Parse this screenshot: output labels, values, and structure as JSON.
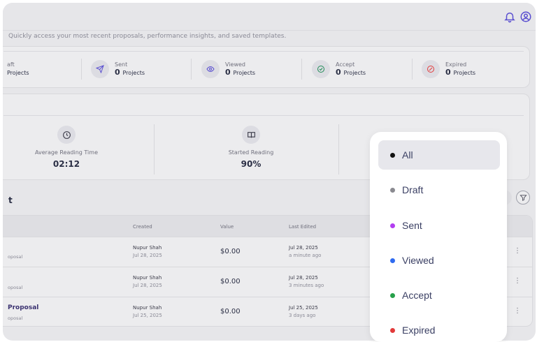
{
  "header": {
    "bell_icon": "bell-icon",
    "profile_icon": "user-circle-icon"
  },
  "overview": {
    "subtitle": "Quickly access your most recent proposals, performance insights, and saved templates.",
    "stats": [
      {
        "label": "aft",
        "count": "",
        "unit": "Projects",
        "icon": ""
      },
      {
        "label": "Sent",
        "count": "0",
        "unit": "Projects",
        "icon": "send-icon"
      },
      {
        "label": "Viewed",
        "count": "0",
        "unit": "Projects",
        "icon": "eye-icon"
      },
      {
        "label": "Accept",
        "count": "0",
        "unit": "Projects",
        "icon": "check-circle-icon"
      },
      {
        "label": "Expired",
        "count": "0",
        "unit": "Projects",
        "icon": "expired-icon"
      }
    ]
  },
  "insights": {
    "metrics": [
      {
        "label": "Average Reading Time",
        "value": "02:12",
        "icon": "clock-icon"
      },
      {
        "label": "Started Reading",
        "value": "90%",
        "icon": "book-icon"
      }
    ]
  },
  "recent": {
    "title_partial": "t",
    "columns": [
      "Created",
      "Value",
      "Last Edited"
    ],
    "rows": [
      {
        "name": "",
        "subtitle": "oposal",
        "creator": "Nupur Shah",
        "created": "Jul 28, 2025",
        "value": "$0.00",
        "edited_date": "Jul 28, 2025",
        "edited_ago": "a minute ago"
      },
      {
        "name": "",
        "subtitle": "oposal",
        "creator": "Nupur Shah",
        "created": "Jul 28, 2025",
        "value": "$0.00",
        "edited_date": "Jul 28, 2025",
        "edited_ago": "3 minutes ago"
      },
      {
        "name": "Proposal",
        "subtitle": "oposal",
        "creator": "Nupur Shah",
        "created": "Jul 25, 2025",
        "value": "$0.00",
        "edited_date": "Jul 25, 2025",
        "edited_ago": "3 days ago"
      }
    ]
  },
  "filter_menu": {
    "options": [
      {
        "label": "All",
        "color": "#111111",
        "selected": true
      },
      {
        "label": "Draft",
        "color": "#8a8a90",
        "selected": false
      },
      {
        "label": "Sent",
        "color": "#b23ef0",
        "selected": false
      },
      {
        "label": "Viewed",
        "color": "#2f6bf0",
        "selected": false
      },
      {
        "label": "Accept",
        "color": "#27a04a",
        "selected": false
      },
      {
        "label": "Expired",
        "color": "#e23a3a",
        "selected": false
      }
    ]
  }
}
